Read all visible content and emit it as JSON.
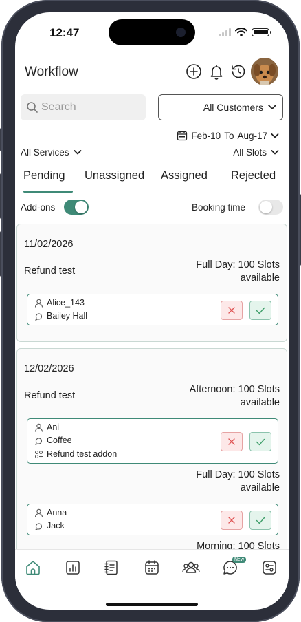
{
  "status": {
    "time": "12:47"
  },
  "header": {
    "title": "Workflow"
  },
  "search": {
    "placeholder": "Search"
  },
  "customer_filter": {
    "selected": "All Customers"
  },
  "date_range": {
    "from": "Feb-10",
    "separator": "To",
    "to": "Aug-17"
  },
  "filters": {
    "services": "All Services",
    "slots": "All Slots"
  },
  "tabs": [
    {
      "label": "Pending",
      "active": true
    },
    {
      "label": "Unassigned",
      "active": false
    },
    {
      "label": "Assigned",
      "active": false
    },
    {
      "label": "Rejected",
      "active": false
    }
  ],
  "toggles": {
    "addons": {
      "label": "Add-ons",
      "on": true
    },
    "booking_time": {
      "label": "Booking time",
      "on": false
    }
  },
  "cards": [
    {
      "date": "11/02/2026",
      "service": "Refund test",
      "slot_groups": [
        {
          "slot_line1": "Full Day: 100 Slots",
          "slot_line2": "available",
          "booking": {
            "customer": "Alice_143",
            "staff": "Bailey Hall",
            "addon": ""
          }
        }
      ]
    },
    {
      "date": "12/02/2026",
      "service": "Refund test",
      "slot_groups": [
        {
          "slot_line1": "Afternoon: 100 Slots",
          "slot_line2": "available",
          "booking": {
            "customer": "Ani",
            "staff": "Coffee",
            "addon": "Refund test addon"
          }
        },
        {
          "slot_line1": "Full Day: 100 Slots",
          "slot_line2": "available",
          "booking": {
            "customer": "Anna",
            "staff": "Jack",
            "addon": ""
          }
        },
        {
          "slot_line1": "Morning: 100 Slots",
          "slot_line2": "",
          "booking": null
        }
      ]
    }
  ],
  "bottom_nav": {
    "items": [
      "home-icon",
      "analytics-icon",
      "notebook-icon",
      "calendar-icon",
      "users-icon",
      "chat-icon",
      "settings-icon"
    ],
    "chat_badge": "New",
    "active": "home-icon"
  },
  "colors": {
    "accent": "#3f8a77",
    "reject": "#e05555",
    "accept": "#3f9f6a"
  }
}
